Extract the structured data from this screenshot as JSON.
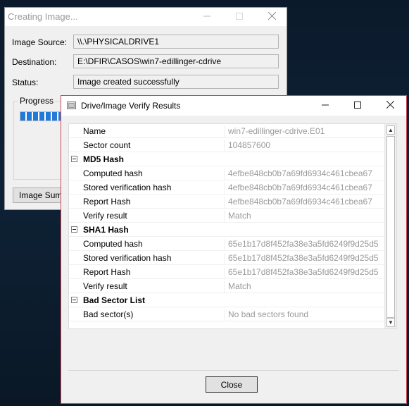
{
  "back_window": {
    "title": "Creating Image...",
    "source_label": "Image Source:",
    "source_value": "\\\\.\\PHYSICALDRIVE1",
    "destination_label": "Destination:",
    "destination_value": "E:\\DFIR\\CASOS\\win7-edillinger-cdrive",
    "status_label": "Status:",
    "status_value": "Image created successfully",
    "progress_label": "Progress",
    "progress_fraction": 1.0,
    "summary_button": "Image Summ"
  },
  "dialog": {
    "title": "Drive/Image Verify Results",
    "close_button": "Close",
    "rows": [
      {
        "type": "field",
        "name": "Name",
        "value": "win7-edillinger-cdrive.E01"
      },
      {
        "type": "field",
        "name": "Sector count",
        "value": "104857600"
      },
      {
        "type": "section",
        "name": "MD5 Hash"
      },
      {
        "type": "field",
        "name": "Computed hash",
        "value": "4efbe848cb0b7a69fd6934c461cbea67"
      },
      {
        "type": "field",
        "name": "Stored verification hash",
        "value": "4efbe848cb0b7a69fd6934c461cbea67"
      },
      {
        "type": "field",
        "name": "Report Hash",
        "value": "4efbe848cb0b7a69fd6934c461cbea67"
      },
      {
        "type": "field",
        "name": "Verify result",
        "value": "Match"
      },
      {
        "type": "section",
        "name": "SHA1 Hash"
      },
      {
        "type": "field",
        "name": "Computed hash",
        "value": "65e1b17d8f452fa38e3a5fd6249f9d25d5"
      },
      {
        "type": "field",
        "name": "Stored verification hash",
        "value": "65e1b17d8f452fa38e3a5fd6249f9d25d5"
      },
      {
        "type": "field",
        "name": "Report Hash",
        "value": "65e1b17d8f452fa38e3a5fd6249f9d25d5"
      },
      {
        "type": "field",
        "name": "Verify result",
        "value": "Match"
      },
      {
        "type": "section",
        "name": "Bad Sector List"
      },
      {
        "type": "field",
        "name": "Bad sector(s)",
        "value": "No bad sectors found"
      }
    ]
  },
  "colors": {
    "accent_border": "#c74a58",
    "progress_blue": "#2379d9"
  }
}
